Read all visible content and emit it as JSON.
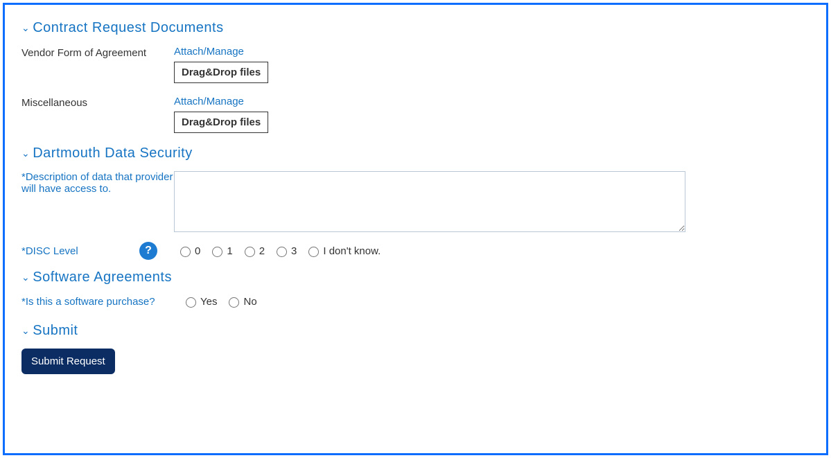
{
  "sections": {
    "contract_docs": {
      "title": "Contract Request Documents",
      "rows": [
        {
          "label": "Vendor Form of Agreement",
          "attach": "Attach/Manage",
          "drop": "Drag&Drop files"
        },
        {
          "label": "Miscellaneous",
          "attach": "Attach/Manage",
          "drop": "Drag&Drop files"
        }
      ]
    },
    "data_security": {
      "title": "Dartmouth Data Security",
      "description_label": "Description of data that provider will have access to.",
      "disc_label": "DISC Level",
      "disc_options": [
        "0",
        "1",
        "2",
        "3",
        "I don't know."
      ]
    },
    "software": {
      "title": "Software Agreements",
      "question_label": "Is this a software purchase?",
      "options": [
        "Yes",
        "No"
      ]
    },
    "submit": {
      "title": "Submit",
      "button": "Submit Request"
    }
  }
}
